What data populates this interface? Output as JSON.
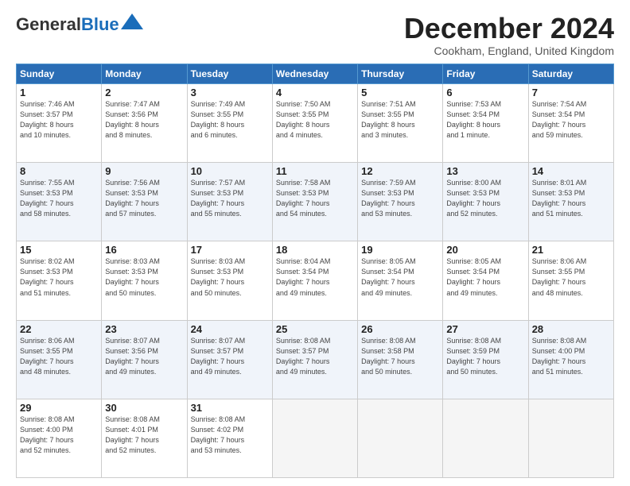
{
  "header": {
    "logo_general": "General",
    "logo_blue": "Blue",
    "title": "December 2024",
    "location": "Cookham, England, United Kingdom"
  },
  "columns": [
    "Sunday",
    "Monday",
    "Tuesday",
    "Wednesday",
    "Thursday",
    "Friday",
    "Saturday"
  ],
  "weeks": [
    [
      {
        "day": "1",
        "info": "Sunrise: 7:46 AM\nSunset: 3:57 PM\nDaylight: 8 hours\nand 10 minutes."
      },
      {
        "day": "2",
        "info": "Sunrise: 7:47 AM\nSunset: 3:56 PM\nDaylight: 8 hours\nand 8 minutes."
      },
      {
        "day": "3",
        "info": "Sunrise: 7:49 AM\nSunset: 3:55 PM\nDaylight: 8 hours\nand 6 minutes."
      },
      {
        "day": "4",
        "info": "Sunrise: 7:50 AM\nSunset: 3:55 PM\nDaylight: 8 hours\nand 4 minutes."
      },
      {
        "day": "5",
        "info": "Sunrise: 7:51 AM\nSunset: 3:55 PM\nDaylight: 8 hours\nand 3 minutes."
      },
      {
        "day": "6",
        "info": "Sunrise: 7:53 AM\nSunset: 3:54 PM\nDaylight: 8 hours\nand 1 minute."
      },
      {
        "day": "7",
        "info": "Sunrise: 7:54 AM\nSunset: 3:54 PM\nDaylight: 7 hours\nand 59 minutes."
      }
    ],
    [
      {
        "day": "8",
        "info": "Sunrise: 7:55 AM\nSunset: 3:53 PM\nDaylight: 7 hours\nand 58 minutes."
      },
      {
        "day": "9",
        "info": "Sunrise: 7:56 AM\nSunset: 3:53 PM\nDaylight: 7 hours\nand 57 minutes."
      },
      {
        "day": "10",
        "info": "Sunrise: 7:57 AM\nSunset: 3:53 PM\nDaylight: 7 hours\nand 55 minutes."
      },
      {
        "day": "11",
        "info": "Sunrise: 7:58 AM\nSunset: 3:53 PM\nDaylight: 7 hours\nand 54 minutes."
      },
      {
        "day": "12",
        "info": "Sunrise: 7:59 AM\nSunset: 3:53 PM\nDaylight: 7 hours\nand 53 minutes."
      },
      {
        "day": "13",
        "info": "Sunrise: 8:00 AM\nSunset: 3:53 PM\nDaylight: 7 hours\nand 52 minutes."
      },
      {
        "day": "14",
        "info": "Sunrise: 8:01 AM\nSunset: 3:53 PM\nDaylight: 7 hours\nand 51 minutes."
      }
    ],
    [
      {
        "day": "15",
        "info": "Sunrise: 8:02 AM\nSunset: 3:53 PM\nDaylight: 7 hours\nand 51 minutes."
      },
      {
        "day": "16",
        "info": "Sunrise: 8:03 AM\nSunset: 3:53 PM\nDaylight: 7 hours\nand 50 minutes."
      },
      {
        "day": "17",
        "info": "Sunrise: 8:03 AM\nSunset: 3:53 PM\nDaylight: 7 hours\nand 50 minutes."
      },
      {
        "day": "18",
        "info": "Sunrise: 8:04 AM\nSunset: 3:54 PM\nDaylight: 7 hours\nand 49 minutes."
      },
      {
        "day": "19",
        "info": "Sunrise: 8:05 AM\nSunset: 3:54 PM\nDaylight: 7 hours\nand 49 minutes."
      },
      {
        "day": "20",
        "info": "Sunrise: 8:05 AM\nSunset: 3:54 PM\nDaylight: 7 hours\nand 49 minutes."
      },
      {
        "day": "21",
        "info": "Sunrise: 8:06 AM\nSunset: 3:55 PM\nDaylight: 7 hours\nand 48 minutes."
      }
    ],
    [
      {
        "day": "22",
        "info": "Sunrise: 8:06 AM\nSunset: 3:55 PM\nDaylight: 7 hours\nand 48 minutes."
      },
      {
        "day": "23",
        "info": "Sunrise: 8:07 AM\nSunset: 3:56 PM\nDaylight: 7 hours\nand 49 minutes."
      },
      {
        "day": "24",
        "info": "Sunrise: 8:07 AM\nSunset: 3:57 PM\nDaylight: 7 hours\nand 49 minutes."
      },
      {
        "day": "25",
        "info": "Sunrise: 8:08 AM\nSunset: 3:57 PM\nDaylight: 7 hours\nand 49 minutes."
      },
      {
        "day": "26",
        "info": "Sunrise: 8:08 AM\nSunset: 3:58 PM\nDaylight: 7 hours\nand 50 minutes."
      },
      {
        "day": "27",
        "info": "Sunrise: 8:08 AM\nSunset: 3:59 PM\nDaylight: 7 hours\nand 50 minutes."
      },
      {
        "day": "28",
        "info": "Sunrise: 8:08 AM\nSunset: 4:00 PM\nDaylight: 7 hours\nand 51 minutes."
      }
    ],
    [
      {
        "day": "29",
        "info": "Sunrise: 8:08 AM\nSunset: 4:00 PM\nDaylight: 7 hours\nand 52 minutes."
      },
      {
        "day": "30",
        "info": "Sunrise: 8:08 AM\nSunset: 4:01 PM\nDaylight: 7 hours\nand 52 minutes."
      },
      {
        "day": "31",
        "info": "Sunrise: 8:08 AM\nSunset: 4:02 PM\nDaylight: 7 hours\nand 53 minutes."
      },
      {
        "day": "",
        "info": ""
      },
      {
        "day": "",
        "info": ""
      },
      {
        "day": "",
        "info": ""
      },
      {
        "day": "",
        "info": ""
      }
    ]
  ]
}
